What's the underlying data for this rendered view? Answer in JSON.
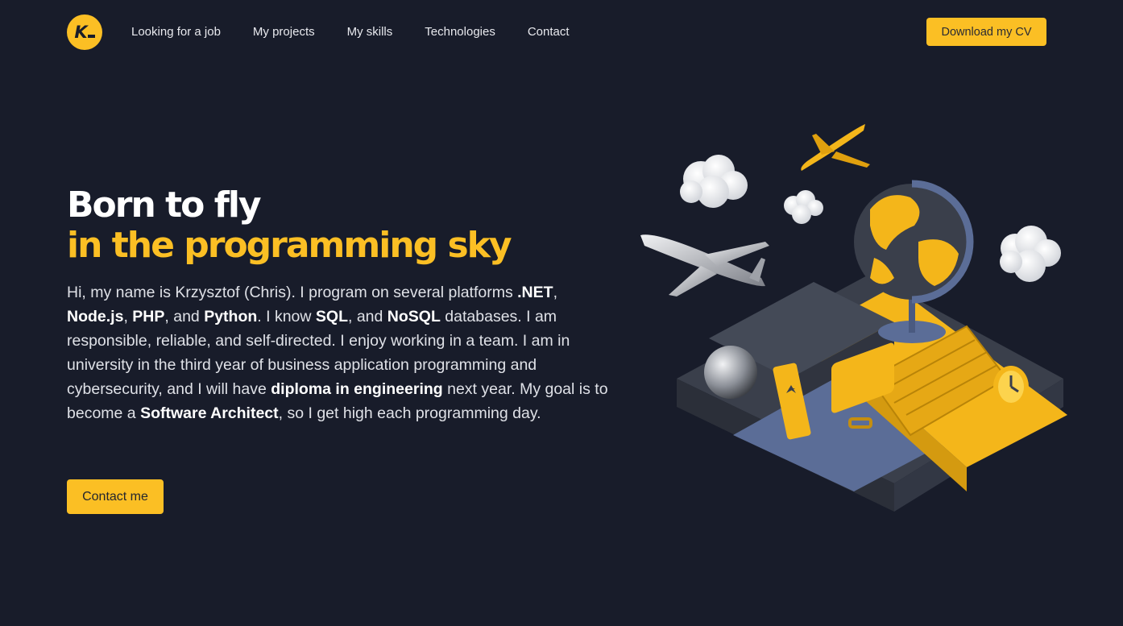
{
  "logo": {
    "text": "K"
  },
  "nav": {
    "links": [
      "Looking for a job",
      "My projects",
      "My skills",
      "Technologies",
      "Contact"
    ],
    "cv_button": "Download my CV"
  },
  "hero": {
    "title_line1": "Born to fly",
    "title_line2": "in the programming sky",
    "intro": [
      {
        "t": "Hi, my name is Krzysztof (Chris). I program on several platforms ",
        "b": false
      },
      {
        "t": ".NET",
        "b": true
      },
      {
        "t": ", ",
        "b": false
      },
      {
        "t": "Node.js",
        "b": true
      },
      {
        "t": ", ",
        "b": false
      },
      {
        "t": "PHP",
        "b": true
      },
      {
        "t": ", and ",
        "b": false
      },
      {
        "t": "Python",
        "b": true
      },
      {
        "t": ". I know ",
        "b": false
      },
      {
        "t": "SQL",
        "b": true
      },
      {
        "t": ", and ",
        "b": false
      },
      {
        "t": "NoSQL",
        "b": true
      },
      {
        "t": " databases. I am responsible, reliable, and self-directed. I enjoy working in a team. I am in university in the third year of business application programming and cybersecurity, and I will have ",
        "b": false
      },
      {
        "t": "diploma in engineering",
        "b": true
      },
      {
        "t": " next year. My goal is to become a ",
        "b": false
      },
      {
        "t": "Software Architect",
        "b": true
      },
      {
        "t": ", so I get high each programming day.",
        "b": false
      }
    ],
    "contact_button": "Contact me"
  },
  "colors": {
    "background": "#181c2a",
    "accent": "#fbbf24",
    "text": "#e6e7ec"
  },
  "illustration": {
    "icons": [
      "cloud-icon",
      "airplane-icon",
      "globe-icon",
      "ticket-icon",
      "suitcase-icon",
      "clock-icon",
      "escalator-icon",
      "sphere-icon"
    ]
  }
}
